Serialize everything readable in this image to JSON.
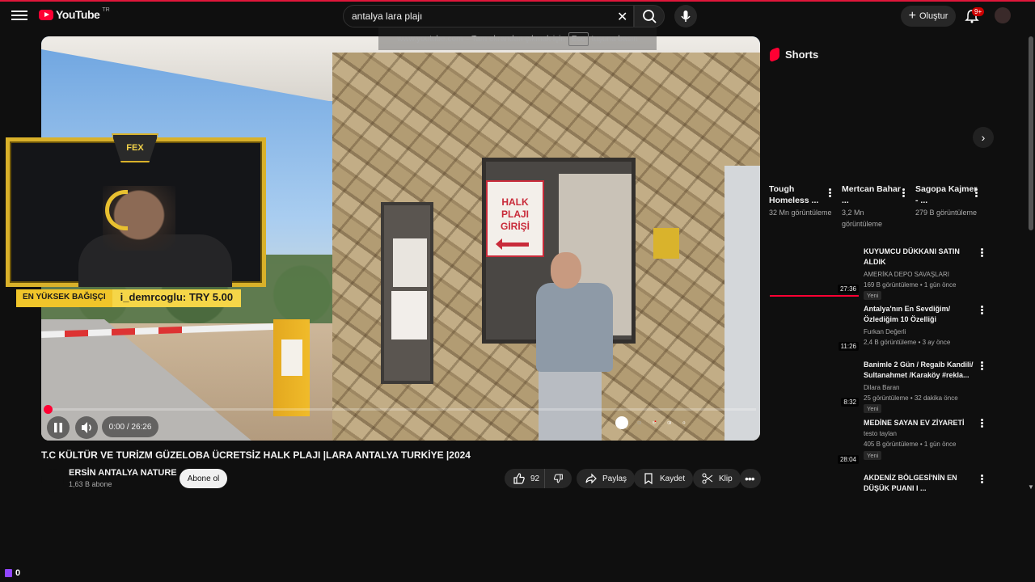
{
  "header": {
    "logo_text": "YouTube",
    "country_code": "TR",
    "search_value": "antalya lara plajı",
    "create_label": "Oluştur",
    "notification_count": "9+"
  },
  "fullscreen_hint": {
    "before": "www.youtube.com – Tam ekrandan çıkmak için",
    "key": "Esc",
    "after": "tuşuna basın"
  },
  "video_overlay": {
    "sign_text_line1": "HALK PLAJI",
    "sign_text_line2": "GİRİŞİ",
    "stream_logo": "FEX",
    "donation_label": "EN YÜKSEK BAĞIŞÇI",
    "donation_value": "i_demrcoglu: TRY 5.00"
  },
  "player": {
    "time": "0:00 / 26:26",
    "progress_fraction": 0.0
  },
  "video": {
    "title": "T.C KÜLTÜR VE TURİZM GÜZELOBA ÜCRETSİZ HALK PLAJI |LARA ANTALYA TURKİYE |2024",
    "channel": "ERSİN ANTALYA NATURE",
    "subscribers": "1,63 B abone",
    "subscribe_label": "Abone ol",
    "likes": "92",
    "share_label": "Paylaş",
    "save_label": "Kaydet",
    "clip_label": "Klip"
  },
  "sidebar": {
    "shorts_title": "Shorts",
    "shorts": [
      {
        "title": "Tough Homeless ...",
        "views": "32 Mn görüntüleme"
      },
      {
        "title": "Mertcan Bahar ...",
        "views": "3,2 Mn görüntüleme"
      },
      {
        "title": "Sagopa Kajmer - ...",
        "views": "279 B görüntüleme"
      }
    ],
    "recommendations": [
      {
        "title": "KUYUMCU DÜKKANI SATIN ALDIK",
        "channel": "AMERİKA DEPO SAVAŞLARI",
        "meta": "169 B görüntüleme • 1 gün önce",
        "badge": "Yeni",
        "duration": "27:36"
      },
      {
        "title": "Antalya'nın En Sevdiğim/ Özlediğim 10 Özelliği",
        "channel": "Furkan Değerli",
        "meta": "2,4 B görüntüleme • 3 ay önce",
        "badge": "",
        "duration": "11:26"
      },
      {
        "title": "Banimle 2 Gün / Regaib Kandili/ Sultanahmet /Karaköy #rekla...",
        "channel": "Dilara Baran",
        "meta": "25 görüntüleme • 32 dakika önce",
        "badge": "Yeni",
        "duration": "8:32"
      },
      {
        "title": "MEDİNE SAYAN EV ZİYARETİ",
        "channel": "testo taylan",
        "meta": "405 B görüntüleme • 1 gün önce",
        "badge": "Yeni",
        "duration": "28:04"
      },
      {
        "title": "AKDENİZ BÖLGESİ'NİN EN DÜŞÜK PUANI I ...",
        "channel": "",
        "meta": "",
        "badge": "",
        "duration": ""
      }
    ]
  },
  "twitch_viewers": "0",
  "colors": {
    "accent": "#ff0033",
    "background": "#0f0f0f",
    "donation": "#f0c52a"
  }
}
